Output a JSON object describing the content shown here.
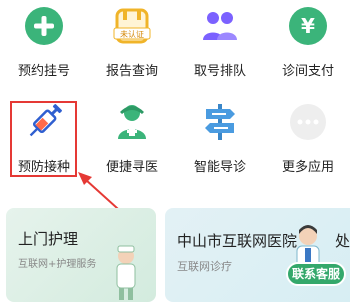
{
  "services": [
    {
      "label": "预约挂号",
      "icon": "plus-circle-icon"
    },
    {
      "label": "报告查询",
      "icon": "report-icon"
    },
    {
      "label": "取号排队",
      "icon": "queue-people-icon"
    },
    {
      "label": "诊间支付",
      "icon": "yuan-circle-icon"
    },
    {
      "label": "预防接种",
      "icon": "syringe-icon"
    },
    {
      "label": "便捷寻医",
      "icon": "doctor-icon"
    },
    {
      "label": "智能导诊",
      "icon": "signpost-icon"
    },
    {
      "label": "更多应用",
      "icon": "more-icon"
    }
  ],
  "report_badge": "未认证",
  "cards": [
    {
      "title": "上门护理",
      "subtitle": "互联网+护理服务"
    },
    {
      "title": "中山市互联网医院",
      "subtitle": "互联网诊疗",
      "peek": "处"
    }
  ],
  "customer_service": "联系客服",
  "colors": {
    "accent": "#34a86b",
    "highlight": "#e53935"
  }
}
